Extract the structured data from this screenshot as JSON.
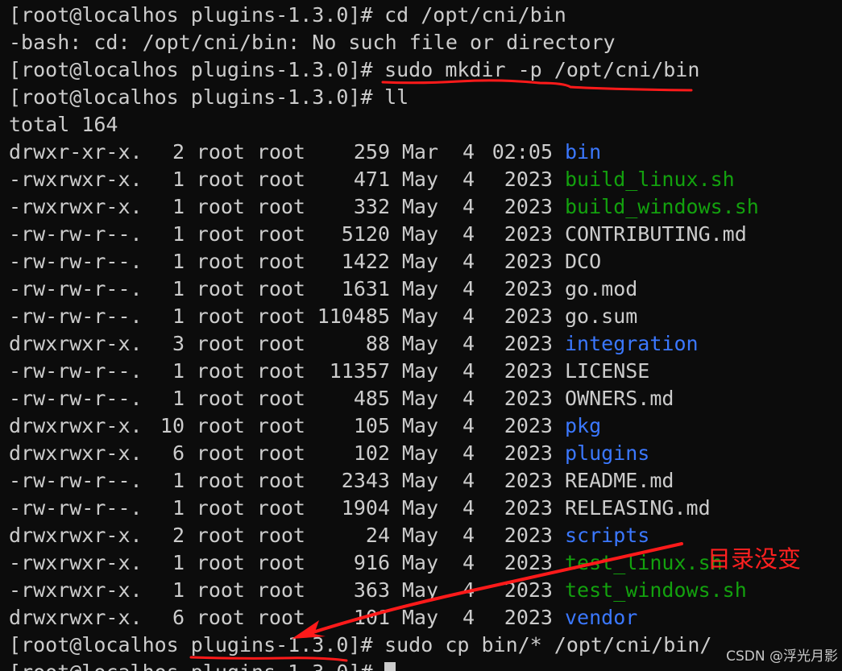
{
  "terminal": {
    "prompt": "[root@localhos plugins-1.3.0]#",
    "commands": {
      "cd": "cd /opt/cni/bin",
      "error": "-bash: cd: /opt/cni/bin: No such file or directory",
      "mkdir": "sudo mkdir -p /opt/cni/bin",
      "ll": "ll",
      "total": "total 164",
      "cp": "sudo cp bin/* /opt/cni/bin/"
    },
    "listing": [
      {
        "perms": "drwxr-xr-x.",
        "links": "2",
        "owner": "root",
        "group": "root",
        "size": "259",
        "month": "Mar",
        "day": "4",
        "time": "02:05",
        "name": "bin",
        "color": "#3b78ff"
      },
      {
        "perms": "-rwxrwxr-x.",
        "links": "1",
        "owner": "root",
        "group": "root",
        "size": "471",
        "month": "May",
        "day": "4",
        "time": "2023",
        "name": "build_linux.sh",
        "color": "#13a10e"
      },
      {
        "perms": "-rwxrwxr-x.",
        "links": "1",
        "owner": "root",
        "group": "root",
        "size": "332",
        "month": "May",
        "day": "4",
        "time": "2023",
        "name": "build_windows.sh",
        "color": "#13a10e"
      },
      {
        "perms": "-rw-rw-r--.",
        "links": "1",
        "owner": "root",
        "group": "root",
        "size": "5120",
        "month": "May",
        "day": "4",
        "time": "2023",
        "name": "CONTRIBUTING.md",
        "color": "#cccccc"
      },
      {
        "perms": "-rw-rw-r--.",
        "links": "1",
        "owner": "root",
        "group": "root",
        "size": "1422",
        "month": "May",
        "day": "4",
        "time": "2023",
        "name": "DCO",
        "color": "#cccccc"
      },
      {
        "perms": "-rw-rw-r--.",
        "links": "1",
        "owner": "root",
        "group": "root",
        "size": "1631",
        "month": "May",
        "day": "4",
        "time": "2023",
        "name": "go.mod",
        "color": "#cccccc"
      },
      {
        "perms": "-rw-rw-r--.",
        "links": "1",
        "owner": "root",
        "group": "root",
        "size": "110485",
        "month": "May",
        "day": "4",
        "time": "2023",
        "name": "go.sum",
        "color": "#cccccc"
      },
      {
        "perms": "drwxrwxr-x.",
        "links": "3",
        "owner": "root",
        "group": "root",
        "size": "88",
        "month": "May",
        "day": "4",
        "time": "2023",
        "name": "integration",
        "color": "#3b78ff"
      },
      {
        "perms": "-rw-rw-r--.",
        "links": "1",
        "owner": "root",
        "group": "root",
        "size": "11357",
        "month": "May",
        "day": "4",
        "time": "2023",
        "name": "LICENSE",
        "color": "#cccccc"
      },
      {
        "perms": "-rw-rw-r--.",
        "links": "1",
        "owner": "root",
        "group": "root",
        "size": "485",
        "month": "May",
        "day": "4",
        "time": "2023",
        "name": "OWNERS.md",
        "color": "#cccccc"
      },
      {
        "perms": "drwxrwxr-x.",
        "links": "10",
        "owner": "root",
        "group": "root",
        "size": "105",
        "month": "May",
        "day": "4",
        "time": "2023",
        "name": "pkg",
        "color": "#3b78ff"
      },
      {
        "perms": "drwxrwxr-x.",
        "links": "6",
        "owner": "root",
        "group": "root",
        "size": "102",
        "month": "May",
        "day": "4",
        "time": "2023",
        "name": "plugins",
        "color": "#3b78ff"
      },
      {
        "perms": "-rw-rw-r--.",
        "links": "1",
        "owner": "root",
        "group": "root",
        "size": "2343",
        "month": "May",
        "day": "4",
        "time": "2023",
        "name": "README.md",
        "color": "#cccccc"
      },
      {
        "perms": "-rw-rw-r--.",
        "links": "1",
        "owner": "root",
        "group": "root",
        "size": "1904",
        "month": "May",
        "day": "4",
        "time": "2023",
        "name": "RELEASING.md",
        "color": "#cccccc"
      },
      {
        "perms": "drwxrwxr-x.",
        "links": "2",
        "owner": "root",
        "group": "root",
        "size": "24",
        "month": "May",
        "day": "4",
        "time": "2023",
        "name": "scripts",
        "color": "#3b78ff"
      },
      {
        "perms": "-rwxrwxr-x.",
        "links": "1",
        "owner": "root",
        "group": "root",
        "size": "916",
        "month": "May",
        "day": "4",
        "time": "2023",
        "name": "test_linux.sh",
        "color": "#13a10e"
      },
      {
        "perms": "-rwxrwxr-x.",
        "links": "1",
        "owner": "root",
        "group": "root",
        "size": "363",
        "month": "May",
        "day": "4",
        "time": "2023",
        "name": "test_windows.sh",
        "color": "#13a10e"
      },
      {
        "perms": "drwxrwxr-x.",
        "links": "6",
        "owner": "root",
        "group": "root",
        "size": "101",
        "month": "May",
        "day": "4",
        "time": "2023",
        "name": "vendor",
        "color": "#3b78ff"
      }
    ]
  },
  "annotation": {
    "text": "目录没变",
    "color": "#ff2020"
  },
  "watermark": "CSDN @浮光月影"
}
